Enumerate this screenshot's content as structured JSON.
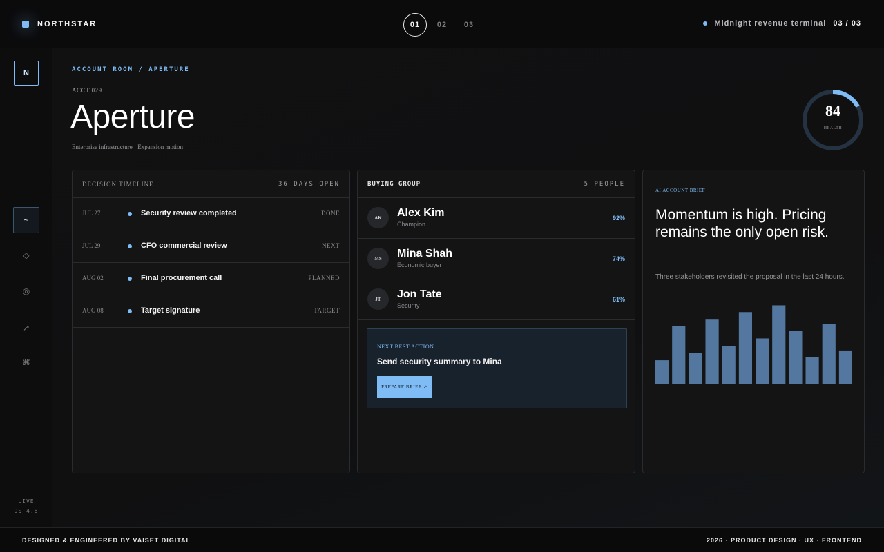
{
  "colors": {
    "accent": "#7fbcf5",
    "bar": "#53779f",
    "ring_track": "#243241"
  },
  "topbar": {
    "brand": "NORTHSTAR",
    "pager": [
      "01",
      "02",
      "03"
    ],
    "pager_active": "01",
    "terminal_label": "Midnight revenue terminal",
    "terminal_count": "03 / 03"
  },
  "sidebar": {
    "logo": "N",
    "nav": [
      {
        "icon": "wave-icon",
        "glyph": "~"
      },
      {
        "icon": "diamond-icon",
        "glyph": "◇"
      },
      {
        "icon": "target-icon",
        "glyph": "◎"
      },
      {
        "icon": "arrow-up-right-icon",
        "glyph": "↗"
      },
      {
        "icon": "command-icon",
        "glyph": "⌘"
      }
    ],
    "status_top": "LIVE",
    "status_bottom": "OS 4.6"
  },
  "header": {
    "breadcrumb": "ACCOUNT ROOM / APERTURE",
    "account_id": "ACCT 029",
    "title": "Aperture",
    "subtitle": "Enterprise infrastructure · Expansion motion",
    "health_value": "84",
    "health_label": "HEALTH",
    "health_score": 84
  },
  "timeline": {
    "title": "DECISION TIMELINE",
    "meta": "36 DAYS OPEN",
    "rows": [
      {
        "date": "JUL 27",
        "label": "Security review completed",
        "status": "DONE"
      },
      {
        "date": "JUL 29",
        "label": "CFO commercial review",
        "status": "NEXT"
      },
      {
        "date": "AUG 02",
        "label": "Final procurement call",
        "status": "PLANNED"
      },
      {
        "date": "AUG 08",
        "label": "Target signature",
        "status": "TARGET"
      }
    ]
  },
  "buying_group": {
    "title": "BUYING GROUP",
    "meta": "5 PEOPLE",
    "people": [
      {
        "initials": "AK",
        "name": "Alex Kim",
        "role": "Champion",
        "score": "92%"
      },
      {
        "initials": "MS",
        "name": "Mina Shah",
        "role": "Economic buyer",
        "score": "74%"
      },
      {
        "initials": "JT",
        "name": "Jon Tate",
        "role": "Security",
        "score": "61%"
      }
    ],
    "next_best_action": {
      "label": "NEXT BEST ACTION",
      "title": "Send security summary to Mina",
      "button": "PREPARE BRIEF ↗"
    }
  },
  "brief": {
    "label": "AI ACCOUNT BRIEF",
    "headline": "Momentum is high. Pricing remains the only open risk.",
    "body": "Three stakeholders revisited the proposal in the last 24 hours."
  },
  "chart_data": {
    "type": "bar",
    "values": [
      32,
      77,
      42,
      86,
      51,
      96,
      61,
      105,
      71,
      36,
      80,
      45
    ],
    "ylim": [
      0,
      110
    ]
  },
  "footer": {
    "left": "DESIGNED & ENGINEERED BY VAISET DIGITAL",
    "right": "2026 · PRODUCT DESIGN · UX · FRONTEND"
  }
}
